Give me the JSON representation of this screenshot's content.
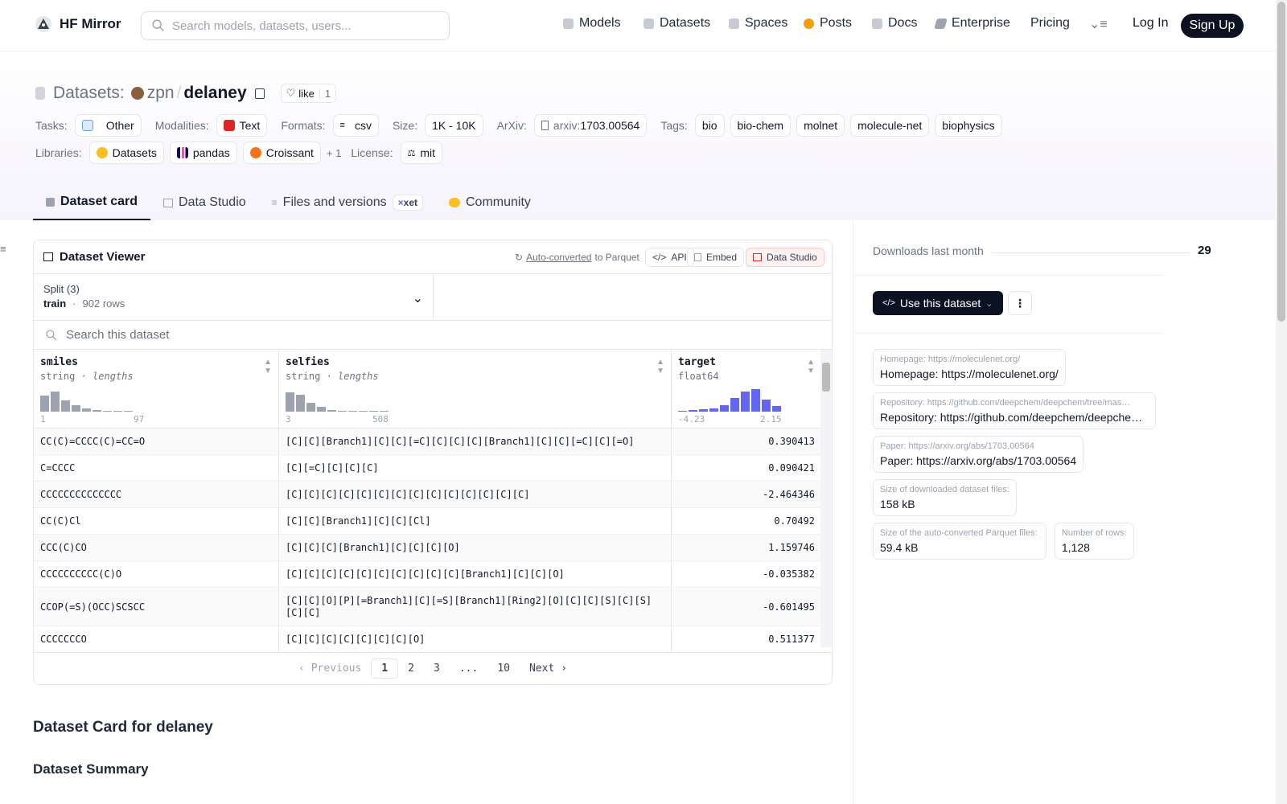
{
  "header": {
    "brand": "HF Mirror",
    "search_placeholder": "Search models, datasets, users...",
    "nav": [
      {
        "label": "Models",
        "icon": "cube-icon",
        "color": "#9ca3af"
      },
      {
        "label": "Datasets",
        "icon": "database-icon",
        "color": "#9ca3af"
      },
      {
        "label": "Spaces",
        "icon": "grid-icon",
        "color": "#9ca3af"
      },
      {
        "label": "Posts",
        "icon": "bubble-icon",
        "color": "#f59e0b"
      },
      {
        "label": "Docs",
        "icon": "book-icon",
        "color": "#9ca3af"
      },
      {
        "label": "Enterprise",
        "icon": "enterprise-icon",
        "color": "#9ca3af"
      },
      {
        "label": "Pricing"
      }
    ],
    "login": "Log In",
    "signup": "Sign Up"
  },
  "breadcrumb": {
    "prefix": "Datasets:",
    "owner": "zpn",
    "sep": "/",
    "name": "delaney",
    "like_label": "like",
    "like_count": "1"
  },
  "tags": {
    "tasks_label": "Tasks:",
    "task": "Other",
    "modalities_label": "Modalities:",
    "modality": "Text",
    "formats_label": "Formats:",
    "format": "csv",
    "size_label": "Size:",
    "size": "1K - 10K",
    "arxiv_label": "ArXiv:",
    "arxiv_prefix": "arxiv:",
    "arxiv": "1703.00564",
    "tags_label": "Tags:",
    "tags": [
      "bio",
      "bio-chem",
      "molnet",
      "molecule-net",
      "biophysics"
    ],
    "libraries_label": "Libraries:",
    "libraries": [
      "Datasets",
      "pandas",
      "Croissant"
    ],
    "more_libraries": "+ 1",
    "license_label": "License:",
    "license": "mit"
  },
  "tabs": [
    {
      "label": "Dataset card",
      "active": true
    },
    {
      "label": "Data Studio"
    },
    {
      "label": "Files and versions",
      "badge": "xet"
    },
    {
      "label": "Community"
    }
  ],
  "viewer": {
    "title": "Dataset Viewer",
    "auto_converted": "Auto-converted",
    "to_parquet": "to Parquet",
    "api": "API",
    "embed": "Embed",
    "data_studio": "Data Studio",
    "split_label": "Split (3)",
    "split_value": "train",
    "split_rows": "902 rows",
    "search_placeholder": "Search this dataset",
    "columns": [
      {
        "name": "smiles",
        "type": "string",
        "extra": "lengths",
        "min": "1",
        "max": "97",
        "hist": [
          0.7,
          0.9,
          0.5,
          0.3,
          0.15,
          0.08,
          0.05,
          0,
          0.05
        ]
      },
      {
        "name": "selfies",
        "type": "string",
        "extra": "lengths",
        "min": "3",
        "max": "508",
        "hist": [
          0.85,
          0.75,
          0.4,
          0.2,
          0.08,
          0.05,
          0,
          0,
          0,
          0.03
        ]
      },
      {
        "name": "target",
        "type": "float64",
        "extra": "",
        "min": "-4.23",
        "max": "2.15",
        "hist": [
          0.05,
          0.07,
          0.1,
          0.15,
          0.3,
          0.6,
          0.9,
          1.0,
          0.55,
          0.25
        ]
      }
    ],
    "rows": [
      [
        "CC(C)=CCCC(C)=CC=O",
        "[C][C][Branch1][C][C][=C][C][C][C][Branch1][C][C][=C][C][=O]",
        "0.390413"
      ],
      [
        "C=CCCC",
        "[C][=C][C][C][C]",
        "0.090421"
      ],
      [
        "CCCCCCCCCCCCCC",
        "[C][C][C][C][C][C][C][C][C][C][C][C][C][C]",
        "-2.464346"
      ],
      [
        "CC(C)Cl",
        "[C][C][Branch1][C][C][Cl]",
        "0.70492"
      ],
      [
        "CCC(C)CO",
        "[C][C][C][Branch1][C][C][C][O]",
        "1.159746"
      ],
      [
        "CCCCCCCCCC(C)O",
        "[C][C][C][C][C][C][C][C][C][C][Branch1][C][C][O]",
        "-0.035382"
      ],
      [
        "CCOP(=S)(OCC)SCSCC",
        "[C][C][O][P][=Branch1][C][=S][Branch1][Ring2][O][C][C][S][C][S][C][C]",
        "-0.601495"
      ],
      [
        "CCCCCCCO",
        "[C][C][C][C][C][C][C][O]",
        "0.511377"
      ]
    ],
    "pager": {
      "prev": "Previous",
      "pages": [
        "1",
        "2",
        "3",
        "...",
        "10"
      ],
      "next": "Next",
      "current": "1"
    }
  },
  "card": {
    "title": "Dataset Card for delaney",
    "summary": "Dataset Summary"
  },
  "sidebar": {
    "downloads_label": "Downloads last month",
    "downloads": "29",
    "use_button": "Use this dataset",
    "homepage_small": "Homepage: https://moleculenet.org/",
    "homepage": "Homepage: https://moleculenet.org/",
    "repo_small": "Repository: https://github.com/deepchem/deepchem/tree/mas…",
    "repo": "Repository: https://github.com/deepchem/deepche…",
    "paper_small": "Paper: https://arxiv.org/abs/1703.00564",
    "paper": "Paper: https://arxiv.org/abs/1703.00564",
    "dl_size_label": "Size of downloaded dataset files:",
    "dl_size": "158 kB",
    "parquet_label": "Size of the auto-converted Parquet files:",
    "parquet_size": "59.4 kB",
    "rows_label": "Number of rows:",
    "rows": "1,128"
  }
}
